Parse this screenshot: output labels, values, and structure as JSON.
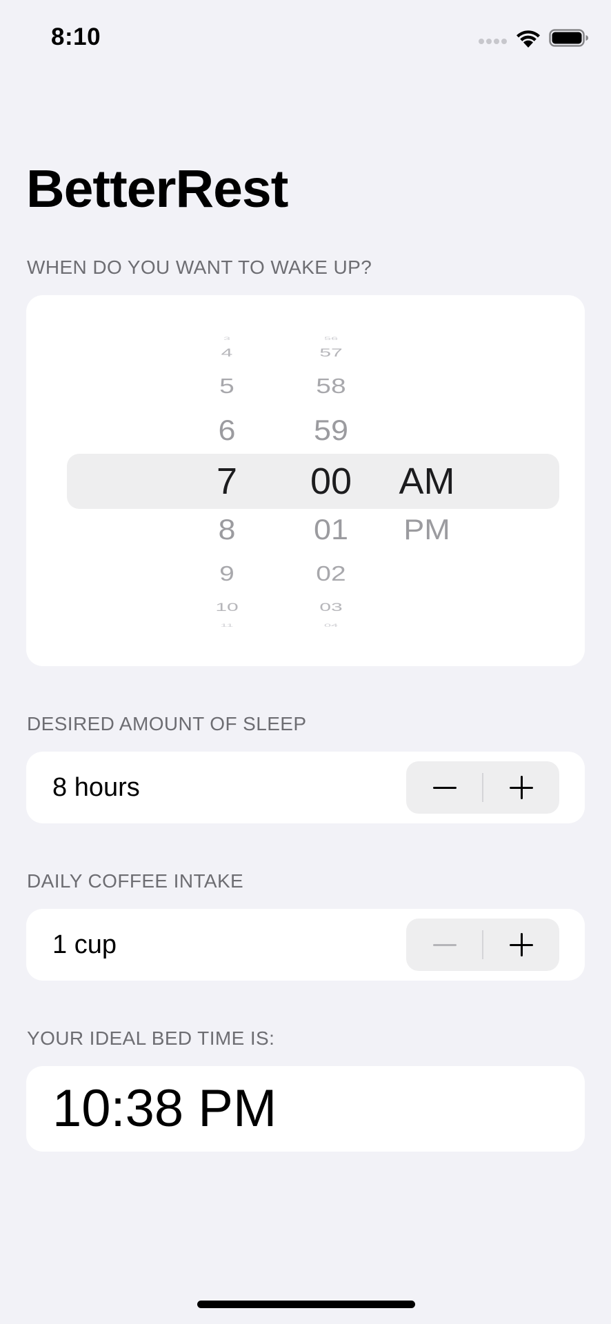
{
  "status_bar": {
    "time": "8:10"
  },
  "app": {
    "title": "BetterRest"
  },
  "wake_section": {
    "header": "WHEN DO YOU WANT TO WAKE UP?",
    "picker": {
      "hours": [
        "3",
        "4",
        "5",
        "6",
        "7",
        "8",
        "9",
        "10",
        "11"
      ],
      "minutes": [
        "56",
        "57",
        "58",
        "59",
        "00",
        "01",
        "02",
        "03",
        "04"
      ],
      "periods": [
        "AM",
        "PM"
      ],
      "selected": {
        "hour": "7",
        "minute": "00",
        "period": "AM"
      }
    }
  },
  "sleep_section": {
    "header": "DESIRED AMOUNT OF SLEEP",
    "value_label": "8 hours",
    "decrement_enabled": true,
    "increment_enabled": true
  },
  "coffee_section": {
    "header": "DAILY COFFEE INTAKE",
    "value_label": "1 cup",
    "decrement_enabled": false,
    "increment_enabled": true
  },
  "result_section": {
    "header": "YOUR IDEAL BED TIME IS:",
    "bedtime": "10:38 PM"
  },
  "colors": {
    "background": "#f2f2f7",
    "card": "#ffffff",
    "section_header": "#6d6d72",
    "picker_highlight": "#eeeeef"
  }
}
